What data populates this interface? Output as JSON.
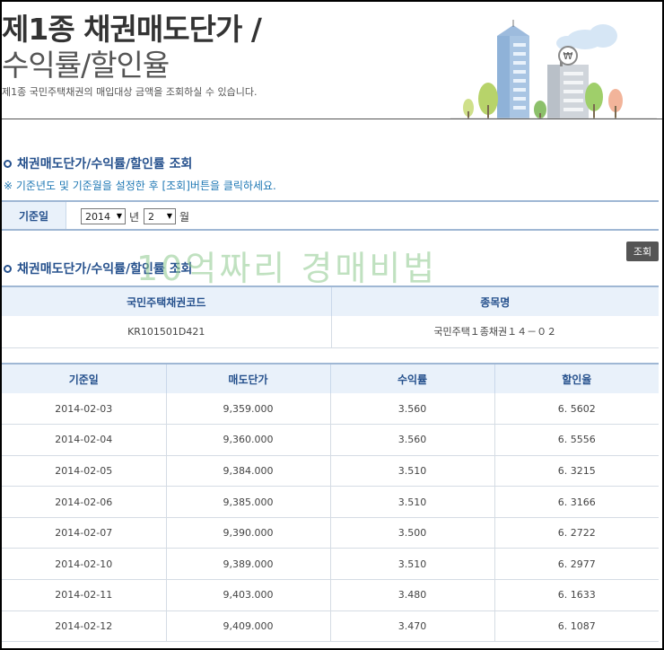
{
  "header": {
    "title_line1": "제1종 채권매도단가 /",
    "title_line2": "수익률/할인율",
    "subtitle": "제1종 국민주택채권의 매입대상 금액을 조회하실 수 있습니다."
  },
  "search": {
    "heading": "채권매도단가/수익률/할인률 조회",
    "note": "※ 기준년도 및 기준월을 설정한 후 [조회]버튼을 클릭하세요.",
    "label": "기준일",
    "year_value": "2014",
    "year_unit": "년",
    "month_value": "2",
    "month_unit": "월"
  },
  "query_button": "조회",
  "result": {
    "heading": "채권매도단가/수익률/할인률 조회",
    "watermark": "10억짜리 경매비법"
  },
  "bond_info": {
    "headers": [
      "국민주택채권코드",
      "종목명"
    ],
    "code": "KR101501D421",
    "name": "국민주택１종채권１４－０２"
  },
  "price_table": {
    "headers": [
      "기준일",
      "매도단가",
      "수익률",
      "할인율"
    ],
    "rows": [
      [
        "2014-02-03",
        "9,359.000",
        "3.560",
        "6. 5602"
      ],
      [
        "2014-02-04",
        "9,360.000",
        "3.560",
        "6. 5556"
      ],
      [
        "2014-02-05",
        "9,384.000",
        "3.510",
        "6. 3215"
      ],
      [
        "2014-02-06",
        "9,385.000",
        "3.510",
        "6. 3166"
      ],
      [
        "2014-02-07",
        "9,390.000",
        "3.500",
        "6. 2722"
      ],
      [
        "2014-02-10",
        "9,389.000",
        "3.510",
        "6. 2977"
      ],
      [
        "2014-02-11",
        "9,403.000",
        "3.480",
        "6. 1633"
      ],
      [
        "2014-02-12",
        "9,409.000",
        "3.470",
        "6. 1087"
      ]
    ]
  },
  "colors": {
    "accent": "#26518d",
    "header_bg": "#e9f1fa",
    "note": "#1f78b4",
    "button": "#555555"
  }
}
